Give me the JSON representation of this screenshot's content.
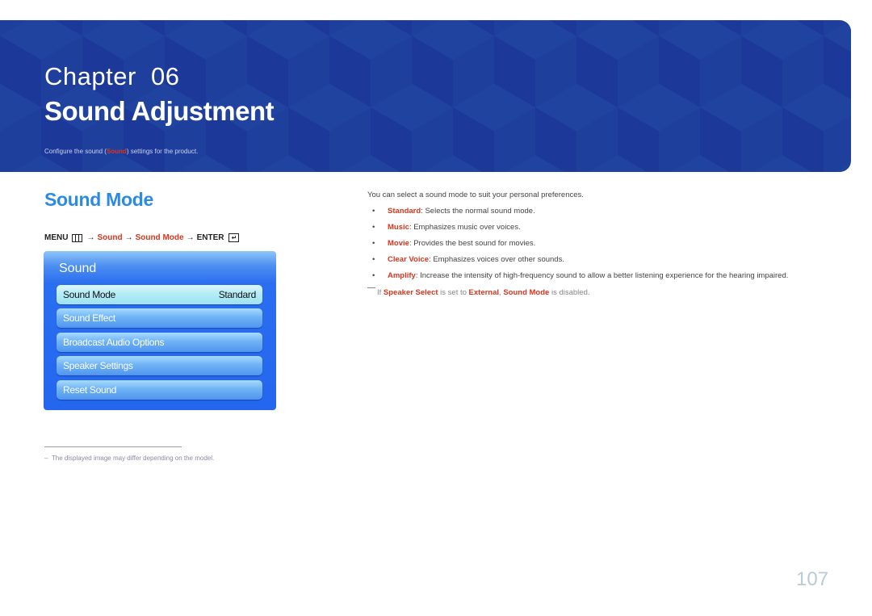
{
  "banner": {
    "chapter_label": "Chapter  06",
    "title": "Sound Adjustment",
    "description_before": "Configure the sound (",
    "description_highlight": "Sound",
    "description_after": ") settings for the product.",
    "colors": {
      "background": "#1f3f9c",
      "accent_red": "#d8361e"
    }
  },
  "section": {
    "title": "Sound Mode",
    "menu_path": {
      "menu_label": "MENU",
      "menu_icon": "menu-grid-icon",
      "arrow": "→",
      "step1": "Sound",
      "step2": "Sound Mode",
      "enter_label": "ENTER",
      "enter_icon": "enter-icon"
    }
  },
  "osd": {
    "title": "Sound",
    "items": [
      {
        "label": "Sound Mode",
        "value": "Standard",
        "selected": true
      },
      {
        "label": "Sound Effect",
        "value": ""
      },
      {
        "label": "Broadcast Audio Options",
        "value": ""
      },
      {
        "label": "Speaker Settings",
        "value": ""
      },
      {
        "label": "Reset Sound",
        "value": ""
      }
    ]
  },
  "footnote": {
    "dash": "‒",
    "text": "The displayed image may differ depending on the model."
  },
  "description": {
    "intro": "You can select a sound mode to suit your personal preferences.",
    "bullets": [
      {
        "term": "Standard",
        "text": ": Selects the normal sound mode."
      },
      {
        "term": "Music",
        "text": ": Emphasizes music over voices."
      },
      {
        "term": "Movie",
        "text": ": Provides the best sound for movies."
      },
      {
        "term": "Clear Voice",
        "text": ": Emphasizes voices over other sounds."
      },
      {
        "term": "Amplify",
        "text": ": Increase the intensity of high-frequency sound to allow a better listening experience for the hearing impaired."
      }
    ],
    "bullet_glyph": "•",
    "note": {
      "prefix": "If ",
      "term1": "Speaker Select",
      "mid1": " is set to ",
      "term2": "External",
      "mid2": ", ",
      "term3": "Sound Mode",
      "suffix": " is disabled."
    }
  },
  "page_number": "107"
}
